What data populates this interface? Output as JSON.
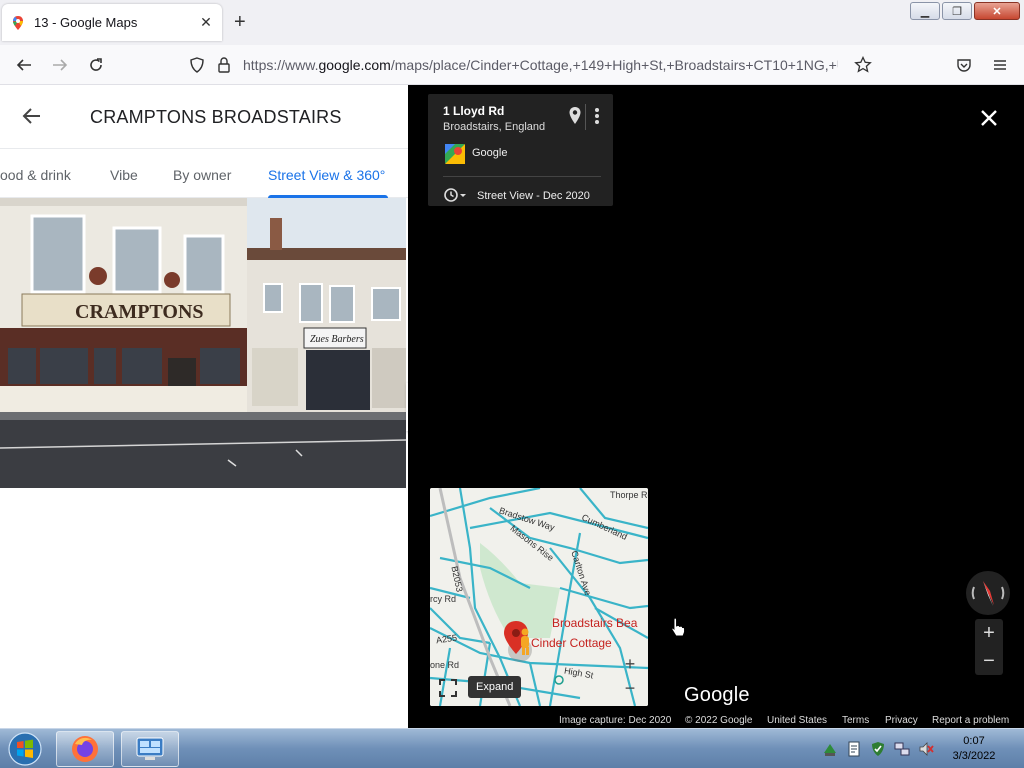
{
  "browser": {
    "tab_title": "13 - Google Maps",
    "new_tab_label": "+",
    "url_prefix": "https://www.",
    "url_host": "google.com",
    "url_rest": "/maps/place/Cinder+Cottage,+149+High+St,+Broadstairs+CT10+1NG,+U"
  },
  "panel": {
    "title": "CRAMPTONS BROADSTAIRS",
    "tabs": [
      {
        "label": "ood & drink"
      },
      {
        "label": "Vibe"
      },
      {
        "label": "By owner"
      },
      {
        "label": "Street View & 360°"
      }
    ],
    "active_tab": 3,
    "photo_signs": {
      "main": "CRAMPTONS",
      "shop": "Zues Barbers"
    }
  },
  "streetview": {
    "address": "1 Lloyd Rd",
    "locality": "Broadstairs, England",
    "provider": "Google",
    "capture": "Street View - Dec 2020",
    "logo": "Google",
    "footer": {
      "capture": "Image capture: Dec 2020",
      "copyright": "© 2022 Google",
      "region": "United States",
      "terms": "Terms",
      "privacy": "Privacy",
      "report": "Report a problem"
    }
  },
  "minimap": {
    "streets": [
      "Thorpe Rd",
      "Bradstow Way",
      "Cumberland",
      "Masons Rise",
      "Carlton Ave",
      "B2053",
      "rcy Rd",
      "A255",
      "High St",
      "one Rd"
    ],
    "places": [
      "Broadstairs Bea",
      "Cinder Cottage"
    ],
    "expand_tooltip": "Expand",
    "zoom_in": "+",
    "zoom_out": "−"
  },
  "sv_controls": {
    "zoom_in": "+",
    "zoom_out": "−"
  },
  "taskbar": {
    "time": "0:07",
    "date": "3/3/2022"
  },
  "colors": {
    "accent_blue": "#1a73e8",
    "map_road": "#3ab4c8",
    "place_red": "#c5221f"
  }
}
